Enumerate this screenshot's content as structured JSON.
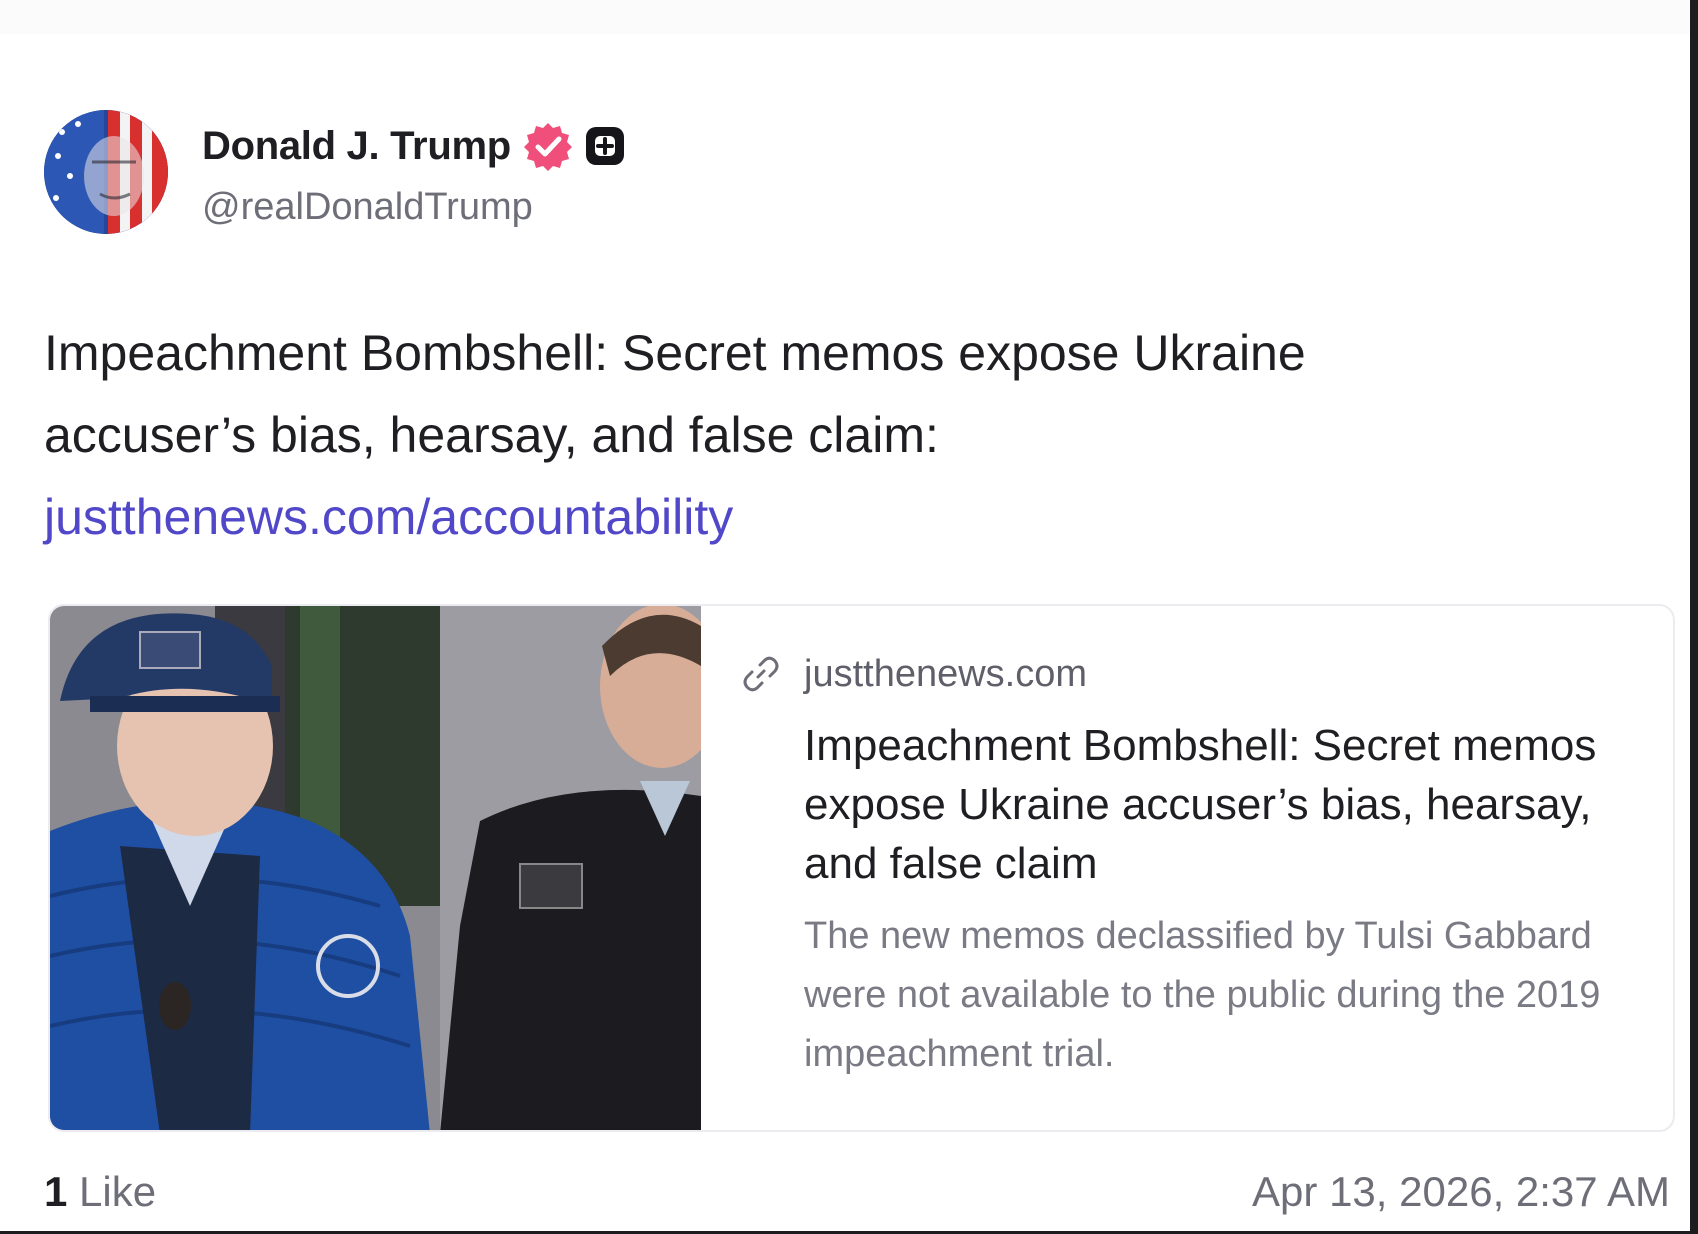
{
  "author": {
    "display_name": "Donald J. Trump",
    "handle": "@realDonaldTrump",
    "avatar_icon": "flag-portrait-avatar",
    "verified_icon": "verified-badge-icon",
    "plus_icon": "plus-badge-icon"
  },
  "post": {
    "text_line1": "Impeachment Bombshell: Secret memos expose Ukraine",
    "text_line2": "accuser’s bias, hearsay, and false claim:",
    "link_text": "justthenews.com/accountability"
  },
  "card": {
    "domain": "justthenews.com",
    "title": "Impeachment Bombshell: Secret memos expose Ukraine accuser’s bias, hearsay, and false claim",
    "description": "The new memos declassified by Tulsi Gabbard were not available to the public during the 2019 impeachment trial.",
    "image_icon": "article-photo"
  },
  "footer": {
    "like_count": "1",
    "like_label": " Like",
    "timestamp": "Apr 13, 2026, 2:37 AM"
  },
  "colors": {
    "link": "#5147c9",
    "verified": "#ef4f7a",
    "text": "#1e1e23",
    "muted": "#6e6e78"
  }
}
